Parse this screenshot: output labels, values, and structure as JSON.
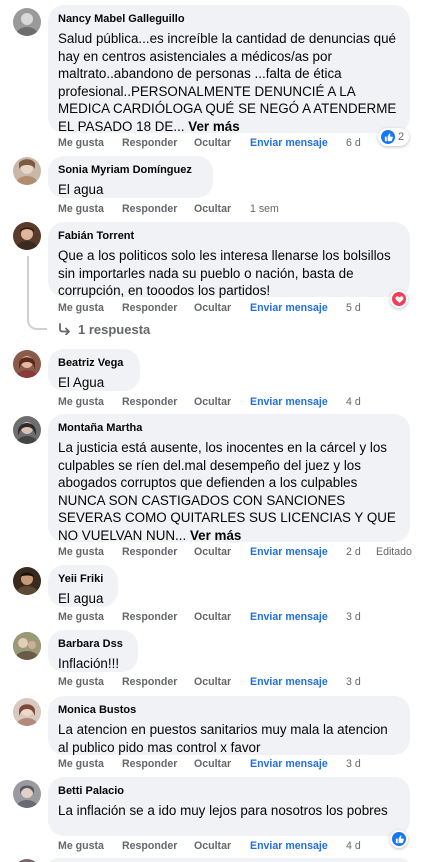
{
  "actions": {
    "like": "Me gusta",
    "reply": "Responder",
    "hide": "Ocultar",
    "send": "Enviar mensaje"
  },
  "read_more": "Ver más",
  "comments": [
    {
      "author": "Nancy Mabel Galleguillo",
      "text": "Salud pública...es increíble la cantidad de denuncias qué hay en centros asistenciales a médicos/as por maltrato..abandono de personas ...falta de ética profesional..PERSONALMENTE DENUNCIÉ A LA MEDICA CARDIÓLOGA QUÉ SE NEGÓ A ATENDERME EL PASADO 18 DE...",
      "time": "6 d",
      "reaction_icon": "like-icon",
      "reaction_count": "2"
    },
    {
      "author": "Sonia Myriam Domínguez",
      "text": "El agua",
      "time": "1 sem"
    },
    {
      "author": "Fabián Torrent",
      "text": "Que a los politicos solo les interesa llenarse los bolsillos sin importarles nada su pueblo o nación, basta de corrupción, en tooodos los partidos!",
      "time": "5 d",
      "reaction_icon": "love-icon",
      "replies_label": "1 respuesta"
    },
    {
      "author": "Beatriz Vega",
      "text": "El Agua",
      "time": "4 d"
    },
    {
      "author": "Montaña Martha",
      "text": "La justicia está ausente, los inocentes en la cárcel y los culpables se ríen del.mal desempeño del juez y los abogados corruptos que defienden a los culpables NUNCA SON CASTIGADOS CON SANCIONES SEVERAS COMO QUITARLES SUS LICENCIAS Y QUE NO VUELVAN NUN...",
      "time": "2 d",
      "edited": "Editado"
    },
    {
      "author": "Yeii Friki",
      "text": "El agua",
      "time": "3 d"
    },
    {
      "author": "Barbara Dss",
      "text": "Inflación!!!",
      "time": "3 d"
    },
    {
      "author": "Monica Bustos",
      "text": "La atencion en puestos sanitarios muy mala la atencion al publico pido mas control x favor",
      "time": "3 d"
    },
    {
      "author": "Betti Palacio",
      "text": "La inflación se a ido muy lejos para nosotros los pobres",
      "time": "4 d",
      "reaction_icon": "like-icon"
    }
  ],
  "colors": {
    "bubble": "#f0f2f5",
    "link": "#216fdb",
    "meta": "#65676b",
    "like": "#1877f2",
    "love": "#f33e58"
  }
}
